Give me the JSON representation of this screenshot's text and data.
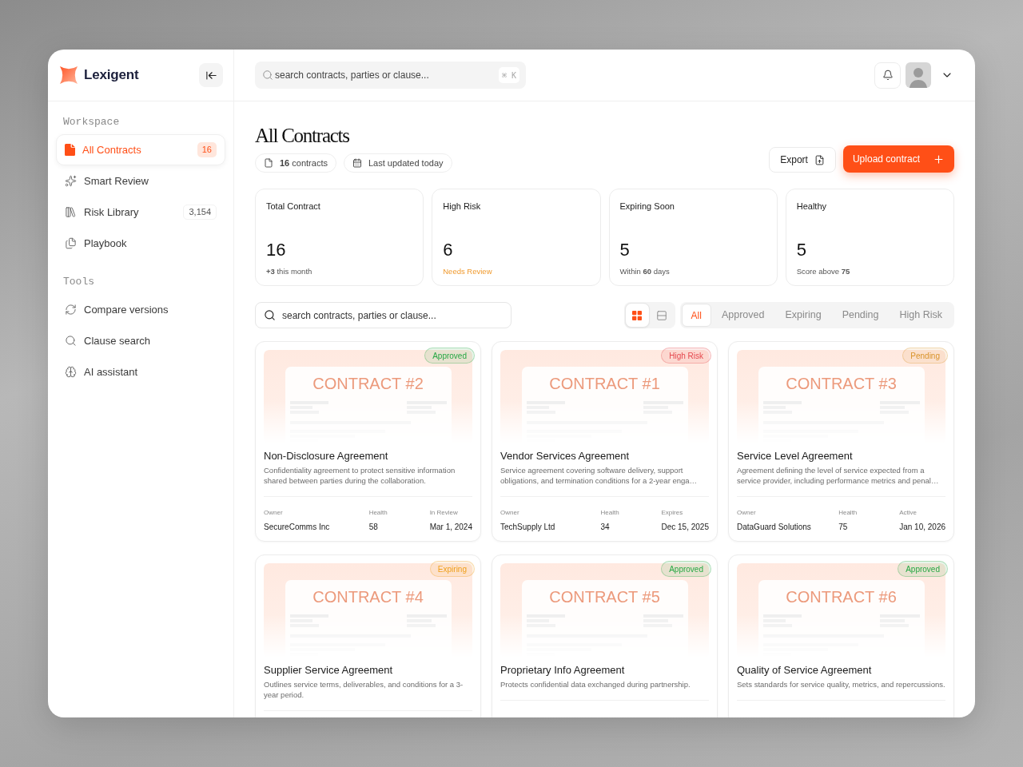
{
  "sidebar": {
    "brand": "Lexigent",
    "sections": [
      {
        "title": "Workspace",
        "items": [
          {
            "label": "All Contracts",
            "count": "16",
            "selected": true
          },
          {
            "label": "Smart Review",
            "selected": false
          },
          {
            "label": "Risk Library",
            "count": "3,154",
            "selected": false
          },
          {
            "label": "Playbook",
            "selected": false
          }
        ]
      },
      {
        "title": "Tools",
        "items": [
          {
            "label": "Compare versions",
            "selected": false
          },
          {
            "label": "Clause search",
            "selected": false
          },
          {
            "label": "AI assistant",
            "selected": false
          }
        ]
      }
    ]
  },
  "topbar": {
    "search": {
      "placeholder": "search contracts, parties or clause...",
      "shortcut": "⌘ K"
    }
  },
  "page": {
    "title": "All Contracts",
    "chips": [
      "**16** contracts",
      "Last updated today"
    ],
    "export": "Export",
    "upload": "Upload contract"
  },
  "stats": [
    {
      "label": "Total Contract",
      "value": "16",
      "note": "**+3** this month",
      "kind": "plain"
    },
    {
      "label": "High Risk",
      "value": "6",
      "note": "Needs Review",
      "kind": "alert"
    },
    {
      "label": "Expiring Soon",
      "value": "5",
      "note": "Within **60** days",
      "kind": "plain"
    },
    {
      "label": "Healthy",
      "value": "5",
      "note": "Score above **75**",
      "kind": "plain"
    }
  ],
  "toolbar": {
    "search": {
      "placeholder": "search contracts, parties or clause..."
    },
    "view_toggle": [
      {
        "selected": true
      },
      {
        "selected": false
      }
    ],
    "filters": [
      {
        "label": "All",
        "selected": true
      },
      {
        "label": "Approved",
        "selected": false
      },
      {
        "label": "Expiring",
        "selected": false
      },
      {
        "label": "Pending",
        "selected": false
      },
      {
        "label": "High Risk",
        "selected": false
      }
    ]
  },
  "contracts": [
    {
      "thumbnail": "CONTRACT #2",
      "status": {
        "label": "Approved",
        "color": "#27a844"
      },
      "title": "Non-Disclosure Agreement",
      "description": "Confidentiality agreement to protect sensitive information shared between parties during the collaboration.",
      "meta": [
        {
          "label": "Owner",
          "value": "SecureComms Inc"
        },
        {
          "label": "Health",
          "value": "58"
        },
        {
          "label": "In Review",
          "value": "Mar 1, 2024"
        }
      ]
    },
    {
      "thumbnail": "CONTRACT #1",
      "status": {
        "label": "High Risk",
        "color": "#e5484d"
      },
      "title": "Vendor Services Agreement",
      "description": "Service agreement covering software delivery, support obligations, and termination conditions for a 2-year enga…",
      "meta": [
        {
          "label": "Owner",
          "value": "TechSupply Ltd"
        },
        {
          "label": "Health",
          "value": "34"
        },
        {
          "label": "Expires",
          "value": "Dec 15, 2025"
        }
      ]
    },
    {
      "thumbnail": "CONTRACT #3",
      "status": {
        "label": "Pending",
        "color": "#d9942c"
      },
      "title": "Service Level Agreement",
      "description": "Agreement defining the level of service expected from a service provider, including performance metrics and penal…",
      "meta": [
        {
          "label": "Owner",
          "value": "DataGuard Solutions"
        },
        {
          "label": "Health",
          "value": "75"
        },
        {
          "label": "Active",
          "value": "Jan 10, 2026"
        }
      ]
    },
    {
      "thumbnail": "CONTRACT #4",
      "status": {
        "label": "Expiring",
        "color": "#ef9f1a"
      },
      "title": "Supplier Service Agreement",
      "description": "Outlines service terms, deliverables, and conditions for a 3-year period."
    },
    {
      "thumbnail": "CONTRACT #5",
      "status": {
        "label": "Approved",
        "color": "#27a844"
      },
      "title": "Proprietary Info Agreement",
      "description": "Protects confidential data exchanged during partnership."
    },
    {
      "thumbnail": "CONTRACT #6",
      "status": {
        "label": "Approved",
        "color": "#27a844"
      },
      "title": "Quality of Service Agreement",
      "description": "Sets standards for service quality, metrics, and repercussions."
    }
  ]
}
